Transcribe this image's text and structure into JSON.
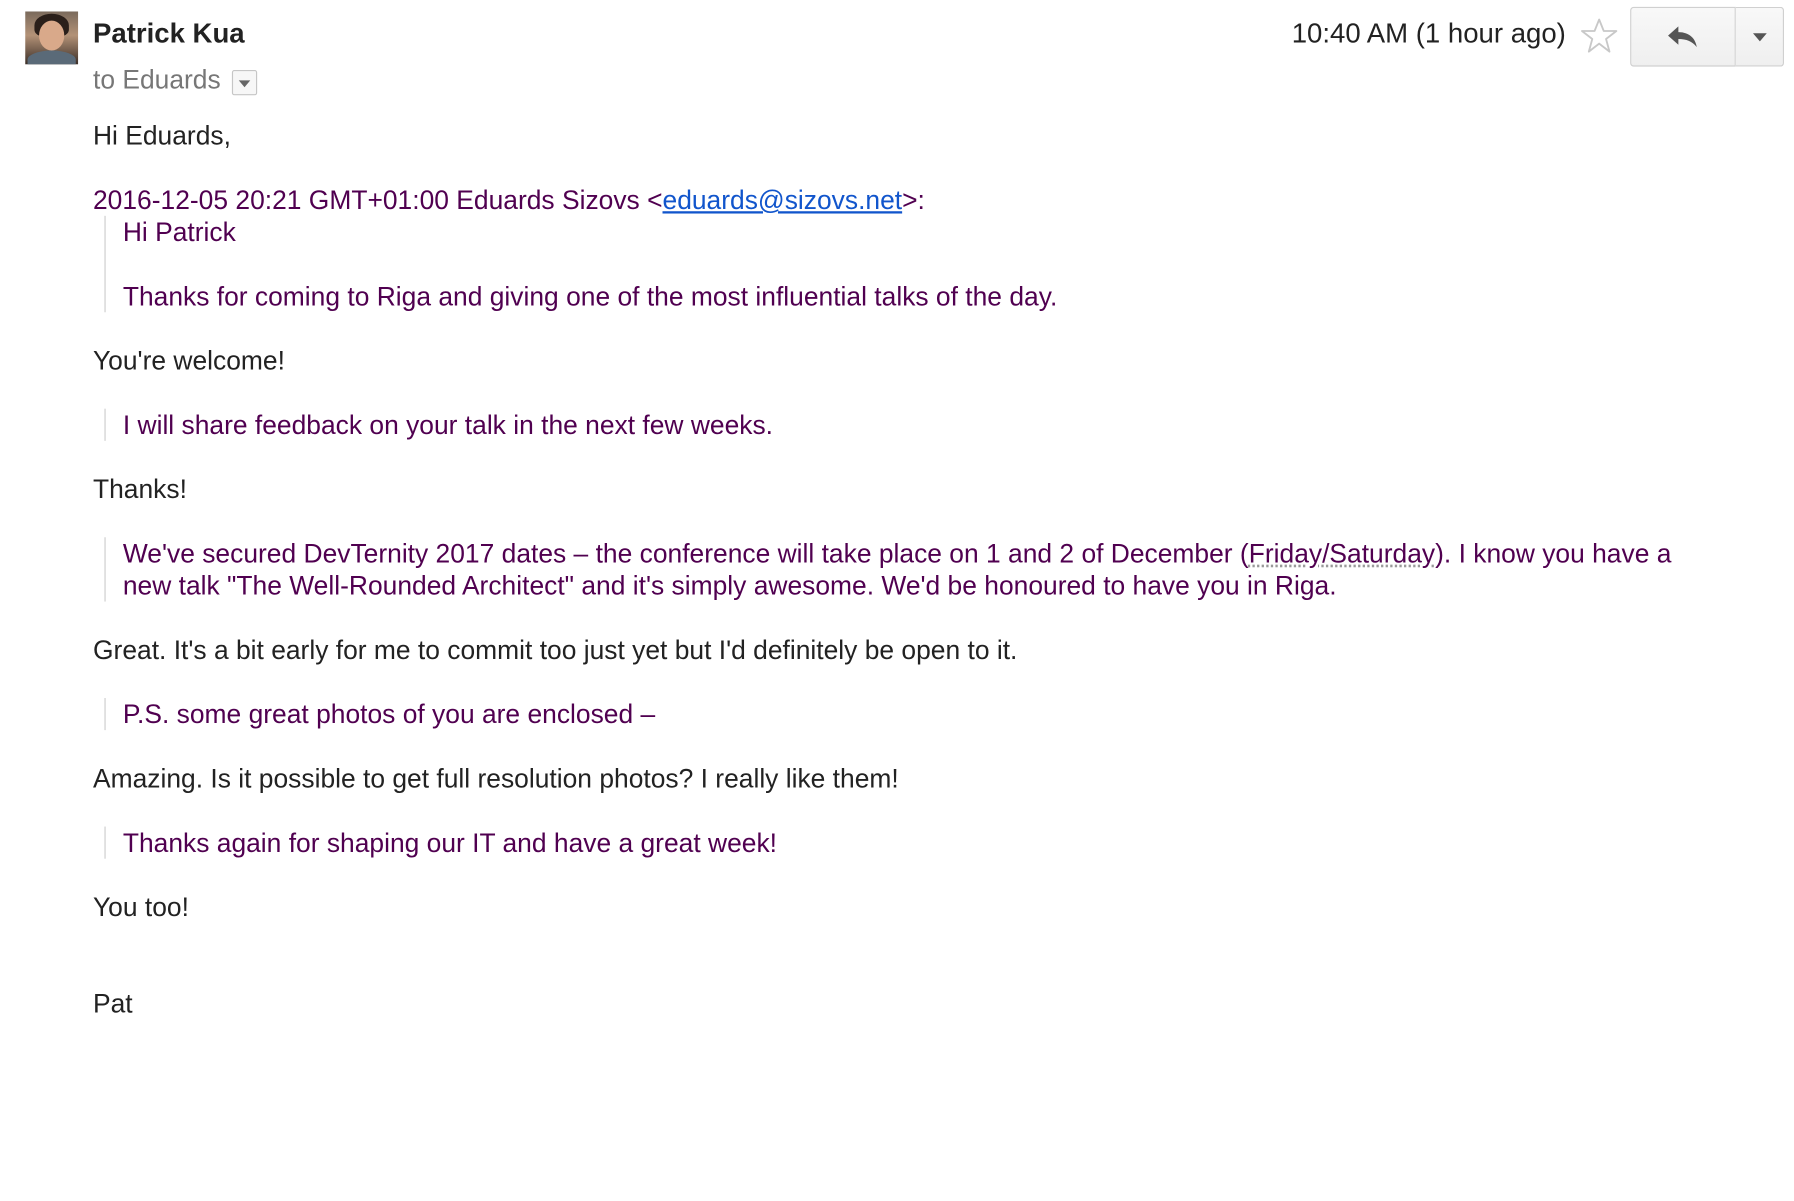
{
  "header": {
    "sender_name": "Patrick Kua",
    "recipient_label": "to Eduards",
    "time": "10:40 AM (1 hour ago)"
  },
  "body": {
    "greeting": "Hi Eduards,",
    "quote_header_prefix": "2016-12-05 20:21 GMT+01:00 Eduards Sizovs <",
    "quote_header_email": "eduards@sizovs.net",
    "quote_header_suffix": ">:",
    "q1_line1": "Hi Patrick",
    "q1_line2": "Thanks for coming to Riga and giving one of the most influential talks of the day.",
    "r1": "You're welcome!",
    "q2": "I will share feedback on your talk in the next few weeks.",
    "r2": "Thanks!",
    "q3_part1": "We've secured DevTernity 2017 dates – the conference will take place on 1 and 2 of December (",
    "q3_spell": "Friday/Saturday",
    "q3_part2": "). I know you have a new talk \"The Well-Rounded Architect\" and it's simply awesome. We'd be honoured to have you in Riga.",
    "r3": "Great. It's a bit early for me to commit too just yet but I'd definitely be open to it.",
    "q4": "P.S. some great photos of you are enclosed –",
    "r4": "Amazing. Is it possible to get full resolution photos? I really like them!",
    "q5": "Thanks again for shaping our IT and have a great week!",
    "r5": "You too!",
    "signature": "Pat"
  },
  "icons": {
    "star": "star-outline-icon",
    "reply": "reply-arrow-icon",
    "more": "caret-down-icon"
  },
  "colors": {
    "quote_text": "#500050",
    "link": "#1155cc",
    "meta_text": "#777777"
  }
}
